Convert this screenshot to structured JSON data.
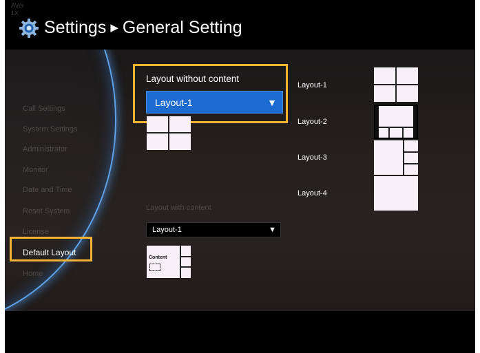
{
  "brand": {
    "line1": "AVer",
    "line2": "1X"
  },
  "header": {
    "section": "Settings",
    "arrow": "▶",
    "page": "General Setting"
  },
  "sidebar": {
    "items": [
      {
        "label": "Call Settings"
      },
      {
        "label": "System Settings"
      },
      {
        "label": "Administrator"
      },
      {
        "label": "Monitor"
      },
      {
        "label": "Date and Time"
      },
      {
        "label": "Reset System"
      },
      {
        "label": "License"
      },
      {
        "label": "Default Layout",
        "active": true
      },
      {
        "label": "Home"
      }
    ]
  },
  "main": {
    "without_content": {
      "label": "Layout without content",
      "selected": "Layout-1",
      "caret": "▼"
    },
    "with_content": {
      "label": "Layout with content",
      "selected": "Layout-1",
      "caret": "▼",
      "preview_text": "Content"
    },
    "options": [
      {
        "label": "Layout-1"
      },
      {
        "label": "Layout-2"
      },
      {
        "label": "Layout-3"
      },
      {
        "label": "Layout-4"
      }
    ]
  },
  "colors": {
    "highlight": "#f5b335",
    "dropdown_selected": "#1b6bd0",
    "arc_glow": "#5fa3ea",
    "thumb_bg": "#f7f0f7"
  },
  "icons": {
    "header": "gear-icon",
    "dropdown": "triangle-down-icon"
  }
}
